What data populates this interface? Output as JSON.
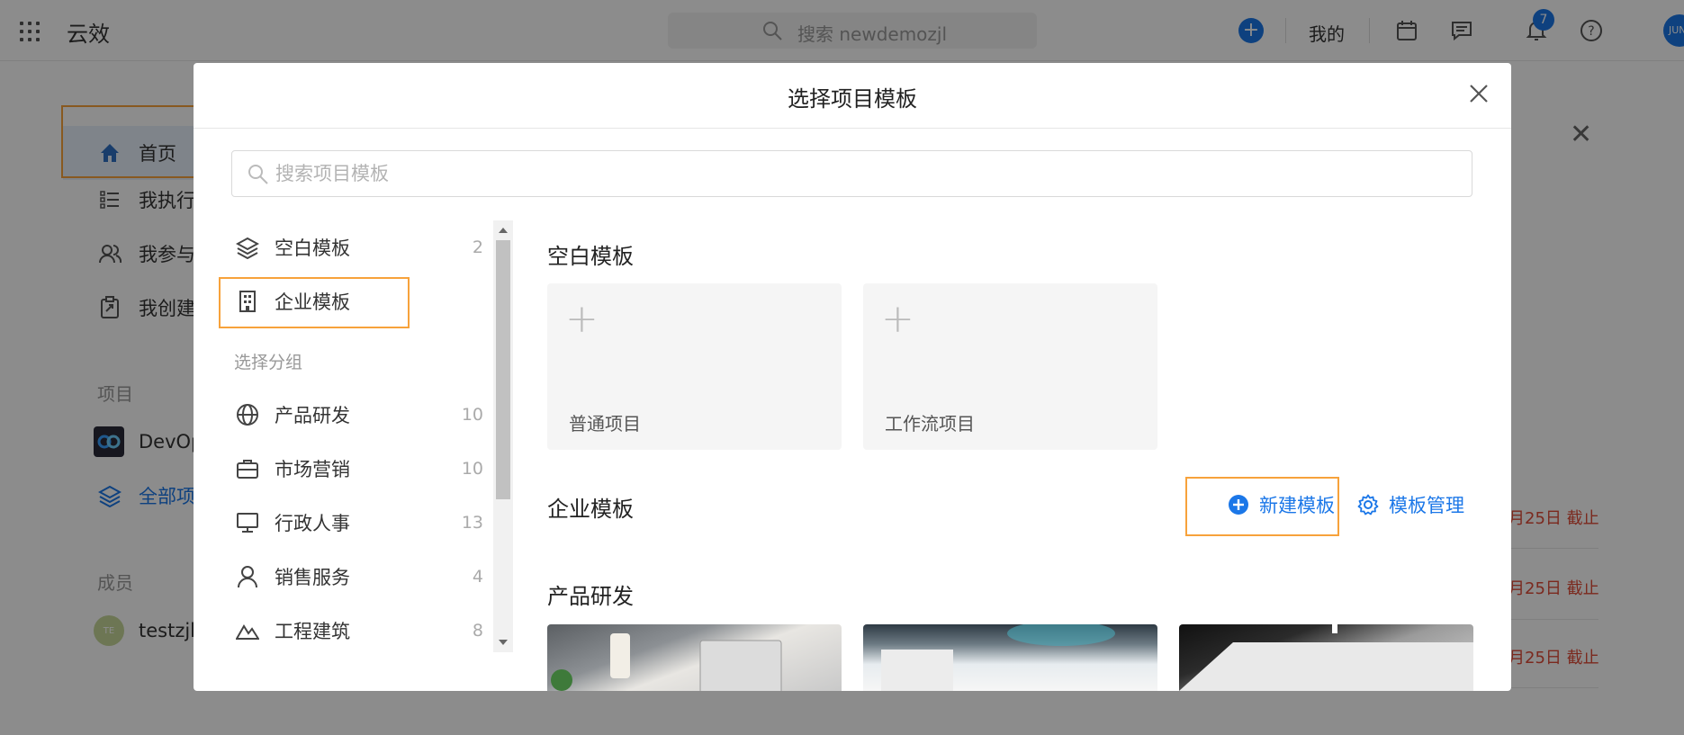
{
  "app": {
    "brand": "云效",
    "search_placeholder": "搜索 newdemozjl",
    "mine_label": "我的",
    "notification_count": "7",
    "avatar_text": "JUN"
  },
  "sidebar": {
    "items": [
      {
        "label": "首页"
      },
      {
        "label": "我执行"
      },
      {
        "label": "我参与"
      },
      {
        "label": "我创建"
      }
    ],
    "project_section": "项目",
    "projects": [
      {
        "label": "DevOp"
      },
      {
        "label": "全部项"
      }
    ],
    "member_section": "成员",
    "members": [
      {
        "label": "testzjl",
        "avatar": "TE"
      }
    ]
  },
  "background_rows": [
    {
      "due": "月25日 截止"
    },
    {
      "due": "月25日 截止"
    },
    {
      "due": "月25日 截止"
    }
  ],
  "modal": {
    "title": "选择项目模板",
    "search_placeholder": "搜索项目模板",
    "categories_top": [
      {
        "label": "空白模板",
        "count": "2",
        "icon": "layers-icon"
      },
      {
        "label": "企业模板",
        "count": "",
        "icon": "building-icon"
      }
    ],
    "group_label": "选择分组",
    "categories_group": [
      {
        "label": "产品研发",
        "count": "10",
        "icon": "globe-icon"
      },
      {
        "label": "市场营销",
        "count": "10",
        "icon": "briefcase-icon"
      },
      {
        "label": "行政人事",
        "count": "13",
        "icon": "monitor-icon"
      },
      {
        "label": "销售服务",
        "count": "4",
        "icon": "person-icon"
      },
      {
        "label": "工程建筑",
        "count": "8",
        "icon": "mountain-icon"
      }
    ],
    "blank_section_title": "空白模板",
    "blank_templates": [
      {
        "label": "普通项目"
      },
      {
        "label": "工作流项目"
      }
    ],
    "enterprise_section_title": "企业模板",
    "new_template_label": "新建模板",
    "manage_template_label": "模板管理",
    "product_section_title": "产品研发"
  },
  "colors": {
    "accent": "#1b77e8",
    "highlight": "#f7a23b",
    "due": "#e04b37"
  }
}
